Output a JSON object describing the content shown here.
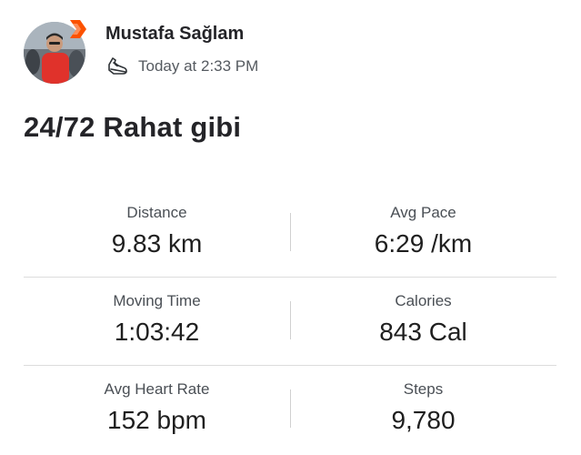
{
  "athlete": {
    "name": "Mustafa Sağlam",
    "badge_color": "#fc5200"
  },
  "activity": {
    "sport_icon": "running-shoe-icon",
    "timestamp": "Today at 2:33 PM",
    "title": "24/72 Rahat gibi"
  },
  "stats": [
    [
      {
        "label": "Distance",
        "value": "9.83 km"
      },
      {
        "label": "Avg Pace",
        "value": "6:29 /km"
      }
    ],
    [
      {
        "label": "Moving Time",
        "value": "1:03:42"
      },
      {
        "label": "Calories",
        "value": "843 Cal"
      }
    ],
    [
      {
        "label": "Avg Heart Rate",
        "value": "152 bpm"
      },
      {
        "label": "Steps",
        "value": "9,780"
      }
    ]
  ]
}
